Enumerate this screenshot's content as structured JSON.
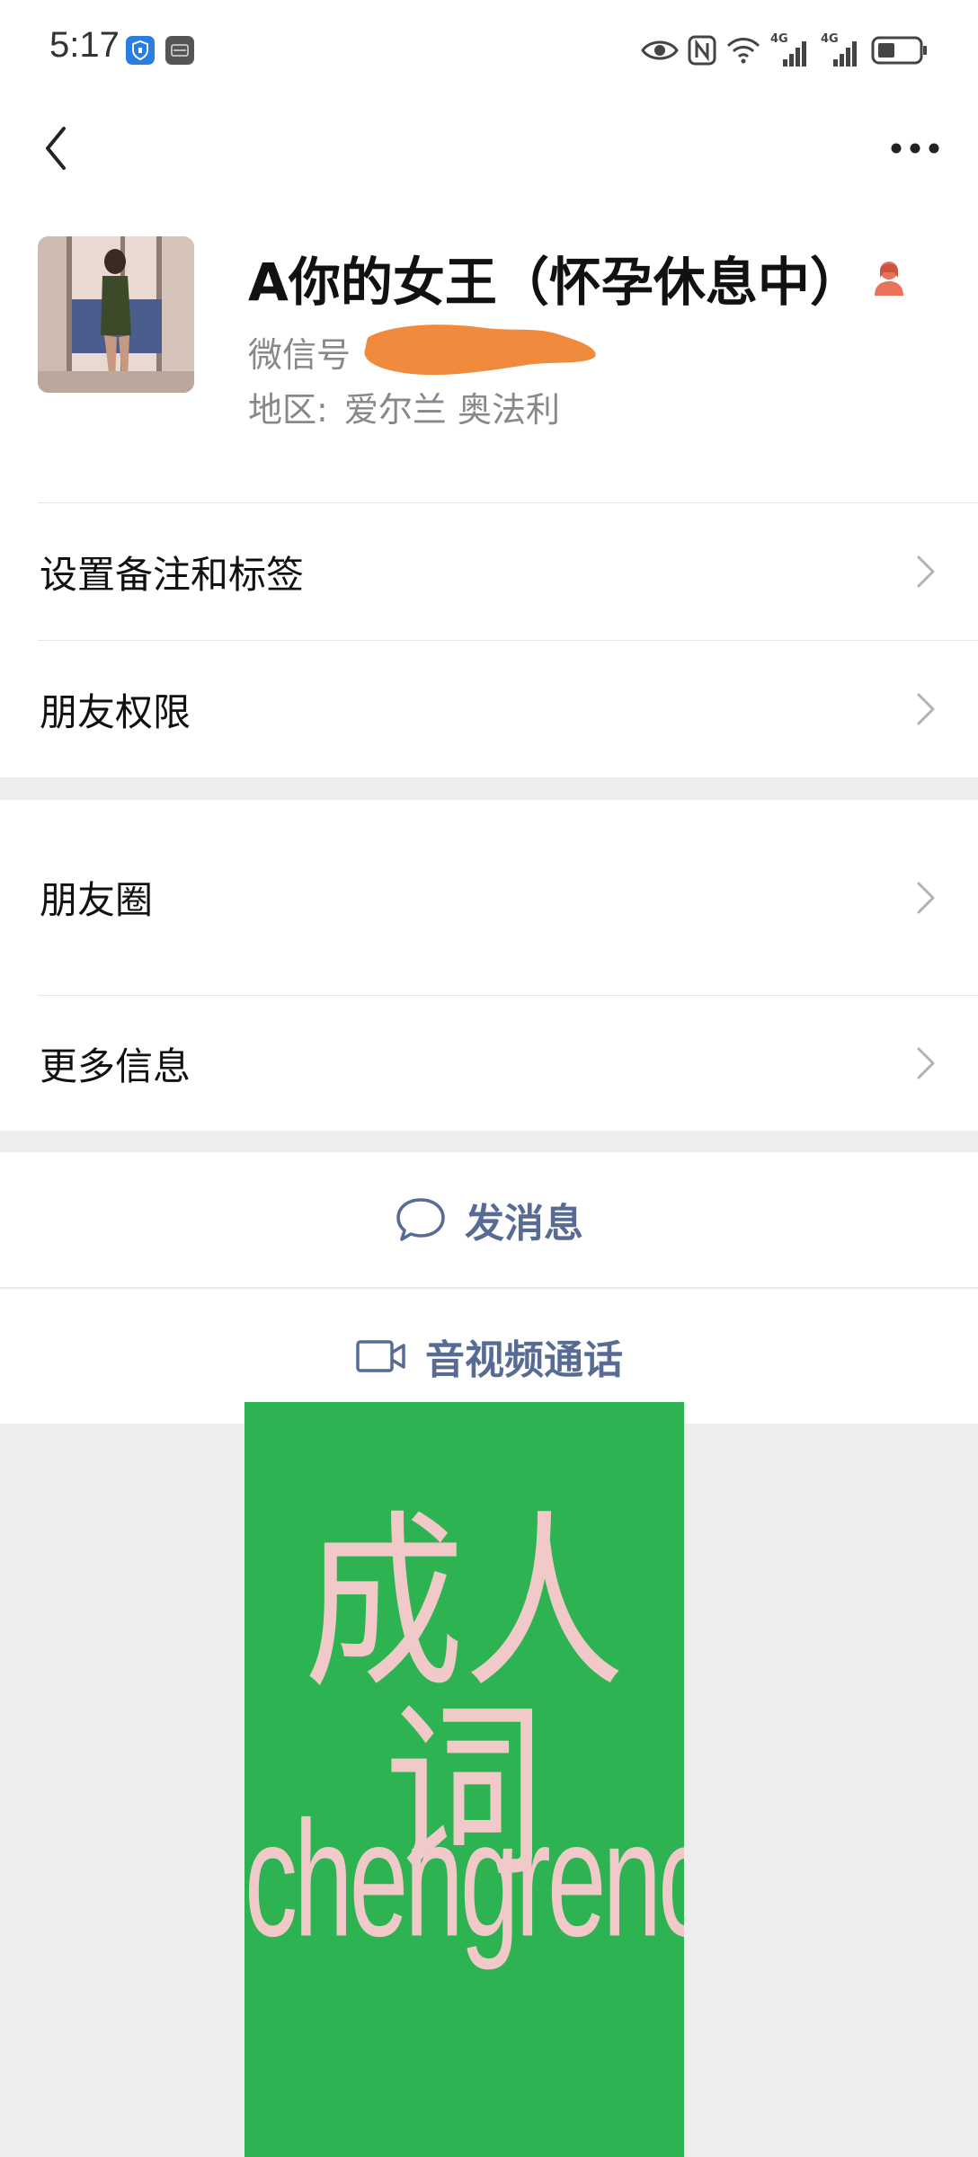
{
  "status_bar": {
    "time": "5:17",
    "left_icons": [
      "shield-icon",
      "huawei-icon"
    ],
    "right_icons": [
      "eye-icon",
      "nfc-icon",
      "wifi-icon",
      "signal-4g-icon",
      "signal-4g-icon",
      "battery-icon"
    ],
    "network_label_1": "4G",
    "network_label_2": "4G"
  },
  "nav": {
    "back_icon": "chevron-left-icon",
    "more_icon": "more-horizontal-icon"
  },
  "profile": {
    "name": "A你的女王（怀孕休息中）",
    "gender_icon": "female-icon",
    "wechat_id_label": "微信号",
    "region_label": "地区:",
    "region_value": "爱尔兰  奥法利",
    "redaction_color": "#f08a3c"
  },
  "list_group_1": {
    "items": [
      {
        "label": "设置备注和标签"
      },
      {
        "label": "朋友权限"
      }
    ]
  },
  "list_group_2": {
    "items": [
      {
        "label": "朋友圈"
      },
      {
        "label": "更多信息"
      }
    ]
  },
  "actions": {
    "message_label": "发消息",
    "message_icon": "chat-bubble-icon",
    "call_label": "音视频通话",
    "call_icon": "video-camera-icon"
  },
  "watermark": {
    "text_cn": "成人词",
    "text_en": "chengrenci.com",
    "background": "#2db351",
    "text_color": "#f1c9c9"
  },
  "colors": {
    "link_blue": "#576b95",
    "page_bg": "#ededed",
    "card_bg": "#ffffff",
    "female_icon": "#e9735a"
  }
}
